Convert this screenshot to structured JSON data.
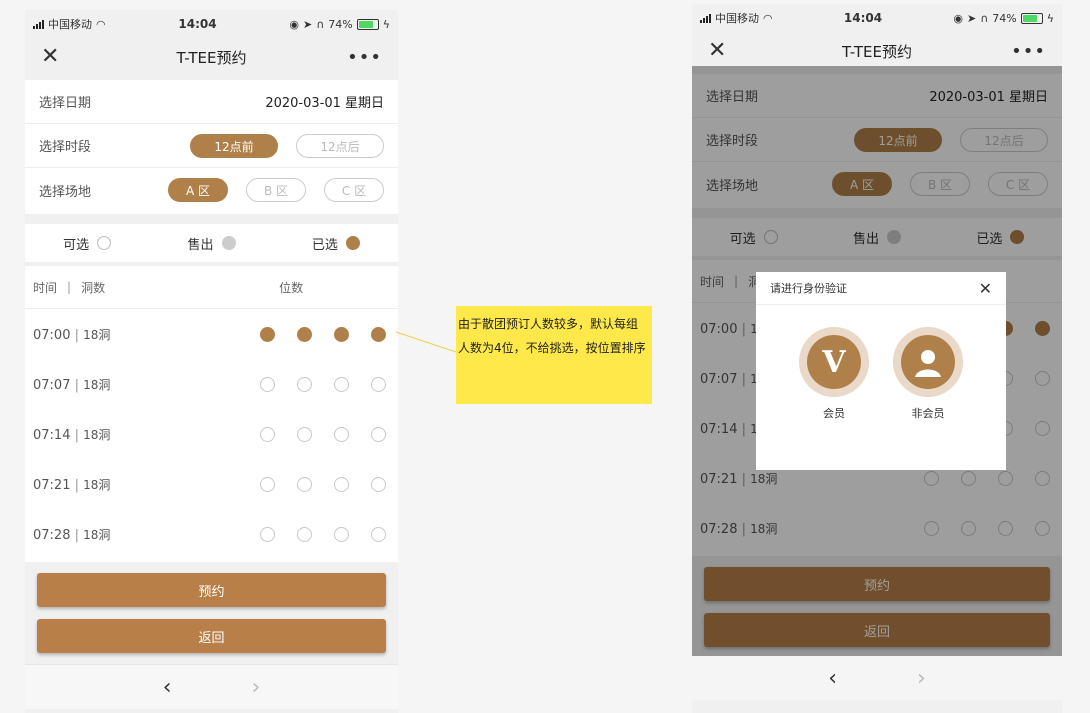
{
  "status_bar": {
    "carrier": "中国移动",
    "time": "14:04",
    "battery": "74%"
  },
  "nav": {
    "title": "T-TEE预约",
    "close_icon": "close-icon",
    "more_icon": "more-icon"
  },
  "form": {
    "date_label": "选择日期",
    "date_value": "2020-03-01 星期日",
    "period_label": "选择时段",
    "periods": [
      "12点前",
      "12点后"
    ],
    "selected_period": "12点前",
    "area_label": "选择场地",
    "areas": [
      "A 区",
      "B 区",
      "C 区"
    ],
    "selected_area": "A 区"
  },
  "legend": {
    "available": "可选",
    "sold": "售出",
    "selected": "已选"
  },
  "table": {
    "time_header": "时间",
    "holes_header": "洞数",
    "seats_header": "位数",
    "rows": [
      {
        "time": "07:00",
        "holes": "18洞",
        "seats": [
          "selected",
          "selected",
          "selected",
          "selected"
        ]
      },
      {
        "time": "07:07",
        "holes": "18洞",
        "seats": [
          "available",
          "available",
          "available",
          "available"
        ]
      },
      {
        "time": "07:14",
        "holes": "18洞",
        "seats": [
          "available",
          "available",
          "available",
          "available"
        ]
      },
      {
        "time": "07:21",
        "holes": "18洞",
        "seats": [
          "available",
          "available",
          "available",
          "available"
        ]
      },
      {
        "time": "07:28",
        "holes": "18洞",
        "seats": [
          "available",
          "available",
          "available",
          "available"
        ]
      }
    ]
  },
  "buttons": {
    "book": "预约",
    "back": "返回"
  },
  "bottom_nav": {
    "back_icon": "chevron-left-icon",
    "forward_icon": "chevron-right-icon"
  },
  "annotation": {
    "text": "由于散团预订人数较多，默认每组人数为4位，不给挑选，按位置排序"
  },
  "modal": {
    "title": "请进行身份验证",
    "member_label": "会员",
    "non_member_label": "非会员",
    "member_icon": "member-v-icon",
    "non_member_icon": "person-icon"
  },
  "colors": {
    "accent": "#b0804a",
    "button": "#b88048",
    "note": "#ffe94a"
  }
}
